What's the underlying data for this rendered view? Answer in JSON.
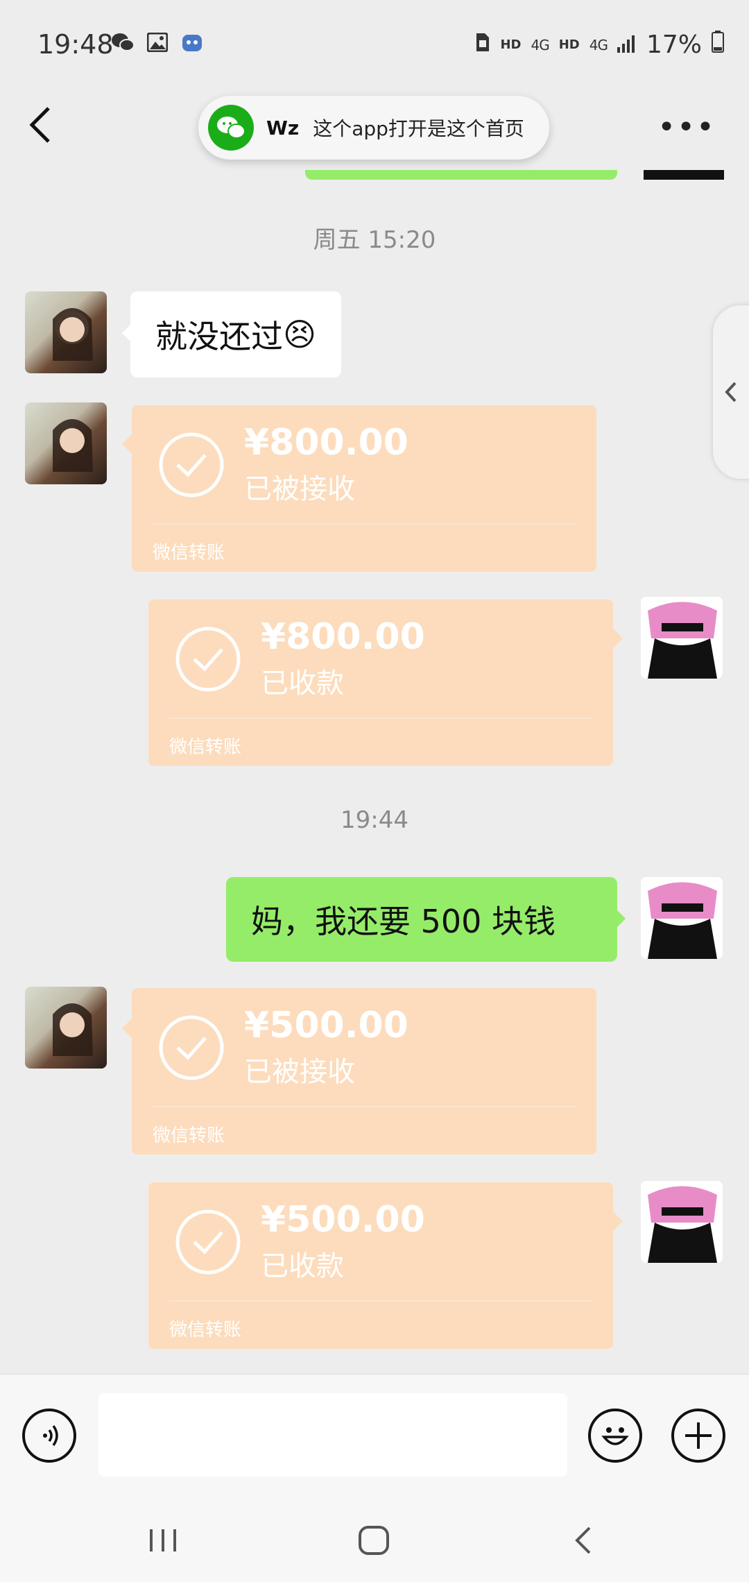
{
  "status_bar": {
    "time": "19:48",
    "left_icons": [
      "wechat-icon",
      "gallery-icon",
      "robot-icon"
    ],
    "network_1": "HD",
    "network_1_type": "4G",
    "network_2": "HD",
    "network_2_type": "4G",
    "battery": "17%"
  },
  "header": {
    "back_icon": "back-arrow-icon",
    "more_label": "•••"
  },
  "notification": {
    "app_icon": "wechat-icon",
    "sender": "Wz",
    "message": "这个app打开是这个首页"
  },
  "chat": {
    "timestamp_1": "周五 15:20",
    "message_1": "就没还过",
    "message_1_emoji": "😣",
    "transfer_1": {
      "amount": "¥800.00",
      "status": "已被接收",
      "footer": "微信转账"
    },
    "transfer_2": {
      "amount": "¥800.00",
      "status": "已收款",
      "footer": "微信转账"
    },
    "timestamp_2": "19:44",
    "message_2": "妈，我还要 500 块钱",
    "transfer_3": {
      "amount": "¥500.00",
      "status": "已被接收",
      "footer": "微信转账"
    },
    "transfer_4": {
      "amount": "¥500.00",
      "status": "已收款",
      "footer": "微信转账"
    }
  },
  "input": {
    "value": "",
    "placeholder": ""
  },
  "colors": {
    "background": "#ededed",
    "bubble_green": "#95ec69",
    "transfer_bg": "#fcdcbd",
    "wechat_green": "#1aad19"
  }
}
